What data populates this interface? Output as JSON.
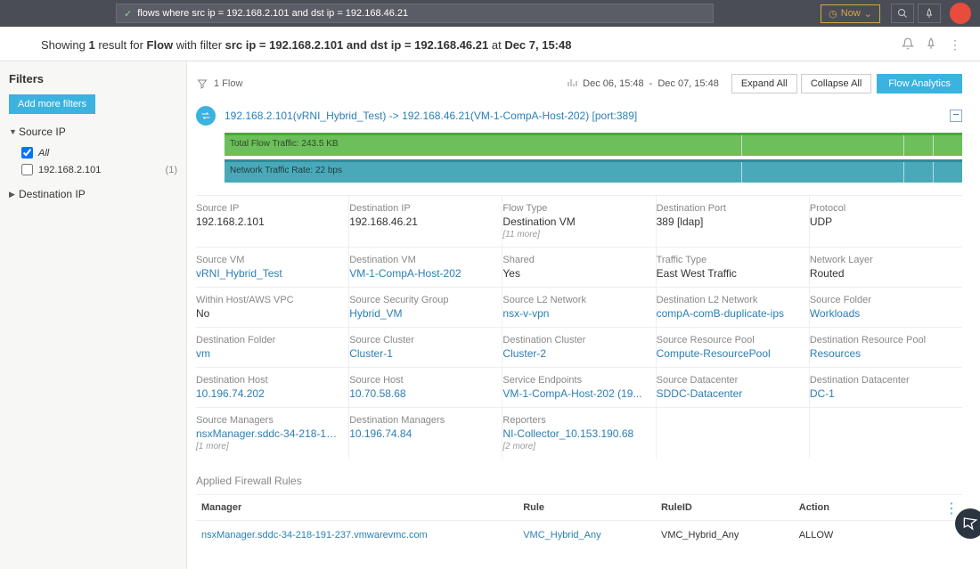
{
  "topbar": {
    "query": "flows where src ip = 192.168.2.101 and dst ip = 192.168.46.21",
    "now_label": "Now"
  },
  "results": {
    "prefix": "Showing ",
    "count": "1",
    "mid1": " result for ",
    "type": "Flow",
    "mid2": " with filter ",
    "filter": "src ip = 192.168.2.101 and dst ip = 192.168.46.21",
    "mid3": " at ",
    "time": "Dec 7, 15:48"
  },
  "sidebar": {
    "filters_label": "Filters",
    "add_filters": "Add more filters",
    "facets": {
      "source_ip": {
        "label": "Source IP",
        "all_label": "All",
        "item0": "192.168.2.101",
        "count0": "(1)"
      },
      "dest_ip": {
        "label": "Destination IP"
      }
    }
  },
  "flowbar": {
    "count_label": "1 Flow",
    "range_from": "Dec 06, 15:48",
    "range_sep": "-",
    "range_to": "Dec 07, 15:48",
    "expand_all": "Expand All",
    "collapse_all": "Collapse All",
    "analytics": "Flow Analytics"
  },
  "flow": {
    "title": "192.168.2.101(vRNI_Hybrid_Test) -> 192.168.46.21(VM-1-CompA-Host-202) [port:389]",
    "bar1_label": "Total Flow Traffic: 243.5 KB",
    "bar2_label": "Network Traffic Rate: 22 bps"
  },
  "props": [
    [
      {
        "k": "Source IP",
        "v": "192.168.2.101",
        "link": false
      },
      {
        "k": "Destination IP",
        "v": "192.168.46.21",
        "link": false
      },
      {
        "k": "Flow Type",
        "v": "Destination VM",
        "link": false,
        "more": "[11 more]"
      },
      {
        "k": "Destination Port",
        "v": "389 [ldap]",
        "link": false
      },
      {
        "k": "Protocol",
        "v": "UDP",
        "link": false
      }
    ],
    [
      {
        "k": "Source VM",
        "v": "vRNI_Hybrid_Test",
        "link": true
      },
      {
        "k": "Destination VM",
        "v": "VM-1-CompA-Host-202",
        "link": true
      },
      {
        "k": "Shared",
        "v": "Yes",
        "link": false
      },
      {
        "k": "Traffic Type",
        "v": "East West Traffic",
        "link": false
      },
      {
        "k": "Network Layer",
        "v": "Routed",
        "link": false
      }
    ],
    [
      {
        "k": "Within Host/AWS VPC",
        "v": "No",
        "link": false
      },
      {
        "k": "Source Security Group",
        "v": "Hybrid_VM",
        "link": true
      },
      {
        "k": "Source L2 Network",
        "v": "nsx-v-vpn",
        "link": true
      },
      {
        "k": "Destination L2 Network",
        "v": "compA-comB-duplicate-ips",
        "link": true
      },
      {
        "k": "Source Folder",
        "v": "Workloads",
        "link": true
      }
    ],
    [
      {
        "k": "Destination Folder",
        "v": "vm",
        "link": true
      },
      {
        "k": "Source Cluster",
        "v": "Cluster-1",
        "link": true
      },
      {
        "k": "Destination Cluster",
        "v": "Cluster-2",
        "link": true
      },
      {
        "k": "Source Resource Pool",
        "v": "Compute-ResourcePool",
        "link": true
      },
      {
        "k": "Destination Resource Pool",
        "v": "Resources",
        "link": true
      }
    ],
    [
      {
        "k": "Destination Host",
        "v": "10.196.74.202",
        "link": true
      },
      {
        "k": "Source Host",
        "v": "10.70.58.68",
        "link": true
      },
      {
        "k": "Service Endpoints",
        "v": "VM-1-CompA-Host-202 (19...",
        "link": true
      },
      {
        "k": "Source Datacenter",
        "v": "SDDC-Datacenter",
        "link": true
      },
      {
        "k": "Destination Datacenter",
        "v": "DC-1",
        "link": true
      }
    ],
    [
      {
        "k": "Source Managers",
        "v": "nsxManager.sddc-34-218-19...",
        "link": true,
        "more": "[1 more]"
      },
      {
        "k": "Destination Managers",
        "v": "10.196.74.84",
        "link": true
      },
      {
        "k": "Reporters",
        "v": "NI-Collector_10.153.190.68",
        "link": true,
        "more": "[2 more]"
      },
      {
        "k": "",
        "v": "",
        "link": false
      },
      {
        "k": "",
        "v": "",
        "link": false
      }
    ]
  ],
  "fw": {
    "heading": "Applied Firewall Rules",
    "th": {
      "manager": "Manager",
      "rule": "Rule",
      "ruleid": "RuleID",
      "action": "Action"
    },
    "row": {
      "manager": "nsxManager.sddc-34-218-191-237.vmwarevmc.com",
      "rule": "VMC_Hybrid_Any",
      "ruleid": "VMC_Hybrid_Any",
      "action": "ALLOW"
    }
  }
}
